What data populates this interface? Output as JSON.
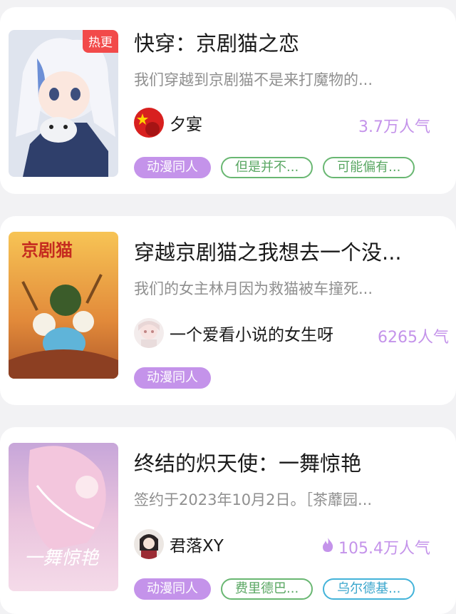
{
  "books": [
    {
      "badge": "热更",
      "title": "快穿：京剧猫之恋",
      "desc": "我们穿越到京剧猫不是来打魔物的...",
      "author": "夕宴",
      "popularity": "3.7万人气",
      "tags": [
        "动漫同人",
        "但是并不...",
        "可能偏有..."
      ]
    },
    {
      "title": "穿越京剧猫之我想去一个没...",
      "desc": "我们的女主林月因为救猫被车撞死...",
      "author": "一个爱看小说的女生呀",
      "popularity": "6265人气",
      "tags": [
        "动漫同人"
      ]
    },
    {
      "title": "终结的炽天使：一舞惊艳",
      "desc": "签约于2023年10月2日。［茶蘼园...",
      "author": "君落XY",
      "popularity": "105.4万人气",
      "tags": [
        "动漫同人",
        "费里德巴...",
        "乌尔德基..."
      ]
    }
  ],
  "colors": {
    "accent": "#c493ea",
    "badge": "#f24a4a",
    "tag_green": "#69b772",
    "tag_cyan": "#43b3d9"
  },
  "icons": {
    "popularity_hot": "fire-icon"
  }
}
